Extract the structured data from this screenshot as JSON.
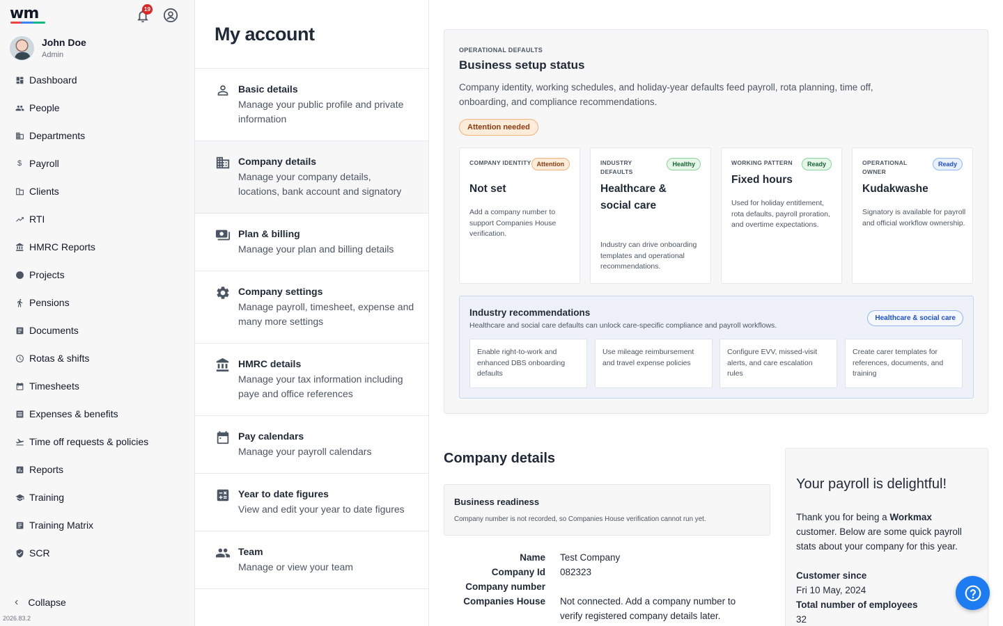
{
  "app": {
    "logo": "wm",
    "version": "2026.83.2"
  },
  "header": {
    "notification_count": "19"
  },
  "user": {
    "name": "John Doe",
    "role": "Admin"
  },
  "sidebar": {
    "items": [
      {
        "label": "Dashboard",
        "icon": "dashboard-icon"
      },
      {
        "label": "People",
        "icon": "people-icon"
      },
      {
        "label": "Departments",
        "icon": "building-icon"
      },
      {
        "label": "Payroll",
        "icon": "dollar-icon"
      },
      {
        "label": "Clients",
        "icon": "clients-icon"
      },
      {
        "label": "RTI",
        "icon": "trend-icon"
      },
      {
        "label": "HMRC Reports",
        "icon": "bank-icon"
      },
      {
        "label": "Projects",
        "icon": "globe-icon"
      },
      {
        "label": "Pensions",
        "icon": "walking-icon"
      },
      {
        "label": "Documents",
        "icon": "document-icon"
      },
      {
        "label": "Rotas & shifts",
        "icon": "clock-icon"
      },
      {
        "label": "Timesheets",
        "icon": "calendar-icon"
      },
      {
        "label": "Expenses & benefits",
        "icon": "receipt-icon"
      },
      {
        "label": "Time off requests & policies",
        "icon": "plane-icon"
      },
      {
        "label": "Reports",
        "icon": "chart-icon"
      },
      {
        "label": "Training",
        "icon": "graduation-icon"
      },
      {
        "label": "Training Matrix",
        "icon": "matrix-icon"
      },
      {
        "label": "SCR",
        "icon": "shield-icon"
      }
    ],
    "collapse_label": "Collapse"
  },
  "account": {
    "title": "My account",
    "menu": [
      {
        "title": "Basic details",
        "desc": "Manage your public profile and private information",
        "icon": "person-icon"
      },
      {
        "title": "Company details",
        "desc": "Manage your company details, locations, bank account and signatory",
        "icon": "company-icon"
      },
      {
        "title": "Plan & billing",
        "desc": "Manage your plan and billing details",
        "icon": "billing-icon"
      },
      {
        "title": "Company settings",
        "desc": "Manage payroll, timesheet, expense and many more settings",
        "icon": "gear-icon"
      },
      {
        "title": "HMRC details",
        "desc": "Manage your tax information including paye and office references",
        "icon": "bank-icon"
      },
      {
        "title": "Pay calendars",
        "desc": "Manage your payroll calendars",
        "icon": "calendar-icon"
      },
      {
        "title": "Year to date figures",
        "desc": "View and edit your year to date figures",
        "icon": "calculator-icon"
      },
      {
        "title": "Team",
        "desc": "Manage or view your team",
        "icon": "team-icon"
      }
    ]
  },
  "setup": {
    "eyebrow": "OPERATIONAL DEFAULTS",
    "title": "Business setup status",
    "desc": "Company identity, working schedules, and holiday-year defaults feed payroll, rota planning, time off, onboarding, and compliance recommendations.",
    "status_pill": "Attention needed",
    "cards": [
      {
        "eyebrow": "COMPANY IDENTITY",
        "pill": "Attention",
        "value": "Not set",
        "desc": "Add a company number to support Companies House verification."
      },
      {
        "eyebrow": "INDUSTRY DEFAULTS",
        "pill": "Healthy",
        "value": "Healthcare & social care",
        "desc": "Industry can drive onboarding templates and operational recommendations."
      },
      {
        "eyebrow": "WORKING PATTERN",
        "pill": "Ready",
        "value": "Fixed hours",
        "desc": "Used for holiday entitlement, rota defaults, payroll proration, and overtime expectations."
      },
      {
        "eyebrow": "OPERATIONAL OWNER",
        "pill": "Ready",
        "value": "Kudakwashe",
        "desc": "Signatory is available for payroll and official workflow ownership."
      }
    ],
    "industry": {
      "title": "Industry recommendations",
      "sub": "Healthcare and social care defaults can unlock care-specific compliance and payroll workflows.",
      "pill": "Healthcare & social care",
      "recs": [
        "Enable right-to-work and enhanced DBS onboarding defaults",
        "Use mileage reimbursement and travel expense policies",
        "Configure EVV, missed-visit alerts, and care escalation rules",
        "Create carer templates for references, documents, and training"
      ]
    }
  },
  "company_details": {
    "title": "Company details",
    "readiness_title": "Business readiness",
    "readiness_desc": "Company number is not recorded, so Companies House verification cannot run yet.",
    "fields": [
      {
        "label": "Name",
        "value": "Test Company"
      },
      {
        "label": "Company Id",
        "value": "082323"
      },
      {
        "label": "Company number",
        "value": ""
      },
      {
        "label": "Companies House",
        "value": "Not connected. Add a company number to verify registered company details later."
      }
    ]
  },
  "payroll_card": {
    "title": "Your payroll is delightful!",
    "body_prefix": "Thank you for being a ",
    "brand": "Workmax",
    "body_suffix": " customer. Below are some quick payroll stats about your company for this year.",
    "customer_since_label": "Customer since",
    "customer_since_value": "Fri 10 May, 2024",
    "employees_label": "Total number of employees",
    "employees_value": "32"
  },
  "colors": {
    "accent": "#1e7cf2",
    "attention": "#f4b27a",
    "healthy": "#86d49b",
    "ready": "#93b4f5"
  }
}
